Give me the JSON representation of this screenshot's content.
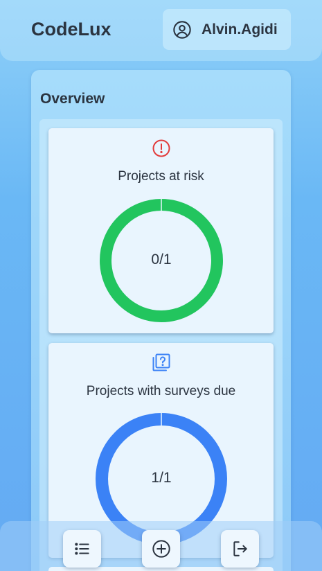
{
  "header": {
    "brand": "CodeLux",
    "user_name": "Alvin.Agidi",
    "user_icon": "user-circle-icon"
  },
  "overview": {
    "title": "Overview",
    "cards": [
      {
        "label": "Projects at risk",
        "icon": "alert-circle-icon",
        "value_text": "0/1",
        "numerator": 0,
        "denominator": 1,
        "fill_fraction": 1.0,
        "ring_color": "#22c55e",
        "icon_color": "#e23b3b"
      },
      {
        "label": "Projects with surveys due",
        "icon": "survey-question-icon",
        "value_text": "1/1",
        "numerator": 1,
        "denominator": 1,
        "fill_fraction": 1.0,
        "ring_color": "#3b82f6",
        "icon_color": "#3b82f6"
      }
    ]
  },
  "bottom_nav": {
    "items": [
      {
        "icon": "list-icon",
        "action": "list"
      },
      {
        "icon": "plus-circle-icon",
        "action": "add"
      },
      {
        "icon": "logout-icon",
        "action": "logout"
      }
    ]
  }
}
